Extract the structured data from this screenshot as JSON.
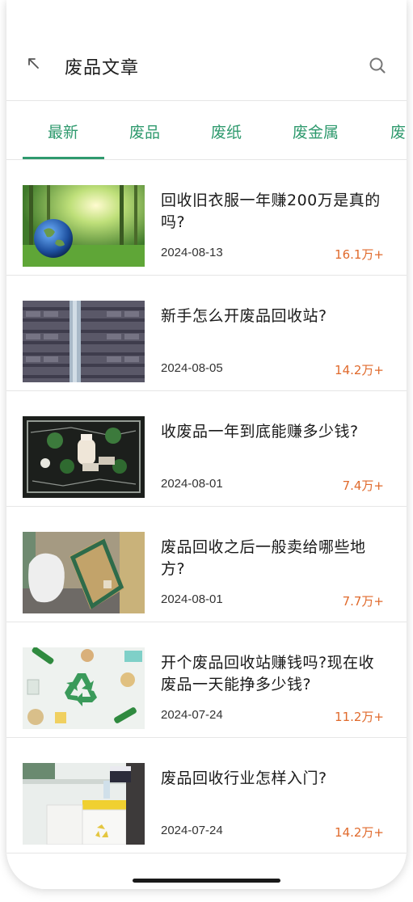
{
  "header": {
    "title": "废品文章",
    "back_icon": "arrow-up-left-icon",
    "search_icon": "search-icon"
  },
  "tabs": [
    {
      "label": "最新",
      "active": true
    },
    {
      "label": "废品",
      "active": false
    },
    {
      "label": "废纸",
      "active": false
    },
    {
      "label": "废金属",
      "active": false
    },
    {
      "label": "废",
      "active": false
    }
  ],
  "articles": [
    {
      "title": "回收旧衣服一年赚200万是真的吗?",
      "date": "2024-08-13",
      "count": "16.1万+",
      "image": "earth-in-forest-image"
    },
    {
      "title": "新手怎么开废品回收站?",
      "date": "2024-08-05",
      "count": "14.2万+",
      "image": "building-facade-image"
    },
    {
      "title": "收废品一年到底能赚多少钱?",
      "date": "2024-08-01",
      "count": "7.4万+",
      "image": "plastic-bottles-image"
    },
    {
      "title": "废品回收之后一般卖给哪些地方?",
      "date": "2024-08-01",
      "count": "7.7万+",
      "image": "recycling-bags-image"
    },
    {
      "title": "开个废品回收站赚钱吗?现在收废品一天能挣多少钱?",
      "date": "2024-07-24",
      "count": "11.2万+",
      "image": "recycle-symbol-image"
    },
    {
      "title": "废品回收行业怎样入门?",
      "date": "2024-07-24",
      "count": "14.2万+",
      "image": "sorting-bins-image"
    }
  ],
  "colors": {
    "accent": "#2f9a6e",
    "count": "#e06a2c",
    "divider": "#e6e6e6"
  }
}
